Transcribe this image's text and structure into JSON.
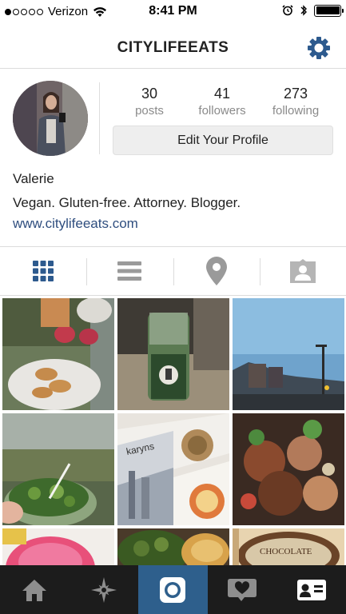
{
  "status_bar": {
    "carrier": "Verizon",
    "time": "8:41 PM",
    "signal_bars_filled": 1,
    "signal_bars_total": 5
  },
  "header": {
    "title": "CITYLIFEEATS",
    "settings_icon": "gear-icon"
  },
  "profile": {
    "stats": [
      {
        "value": "30",
        "label": "posts"
      },
      {
        "value": "41",
        "label": "followers"
      },
      {
        "value": "273",
        "label": "following"
      }
    ],
    "edit_button": "Edit Your Profile",
    "name": "Valerie",
    "bio": "Vegan. Gluten-free. Attorney. Blogger.",
    "website": "www.citylifeeats.com"
  },
  "view_tabs": [
    {
      "icon": "grid-icon",
      "active": true
    },
    {
      "icon": "list-icon",
      "active": false
    },
    {
      "icon": "map-pin-icon",
      "active": false
    },
    {
      "icon": "tagged-photos-icon",
      "active": false
    }
  ],
  "bottom_nav": [
    {
      "icon": "home-icon",
      "active": false
    },
    {
      "icon": "explore-star-icon",
      "active": false
    },
    {
      "icon": "camera-icon",
      "active": true
    },
    {
      "icon": "activity-heart-icon",
      "active": false
    },
    {
      "icon": "profile-card-icon",
      "active": false
    }
  ],
  "colors": {
    "accent_blue": "#2f4e7f",
    "grid_icon_blue": "#2d5a8e",
    "bottom_bar": "#1c1c1c",
    "bottom_bar_active": "#2e5f8c",
    "muted_icon": "#9a9a9a"
  }
}
